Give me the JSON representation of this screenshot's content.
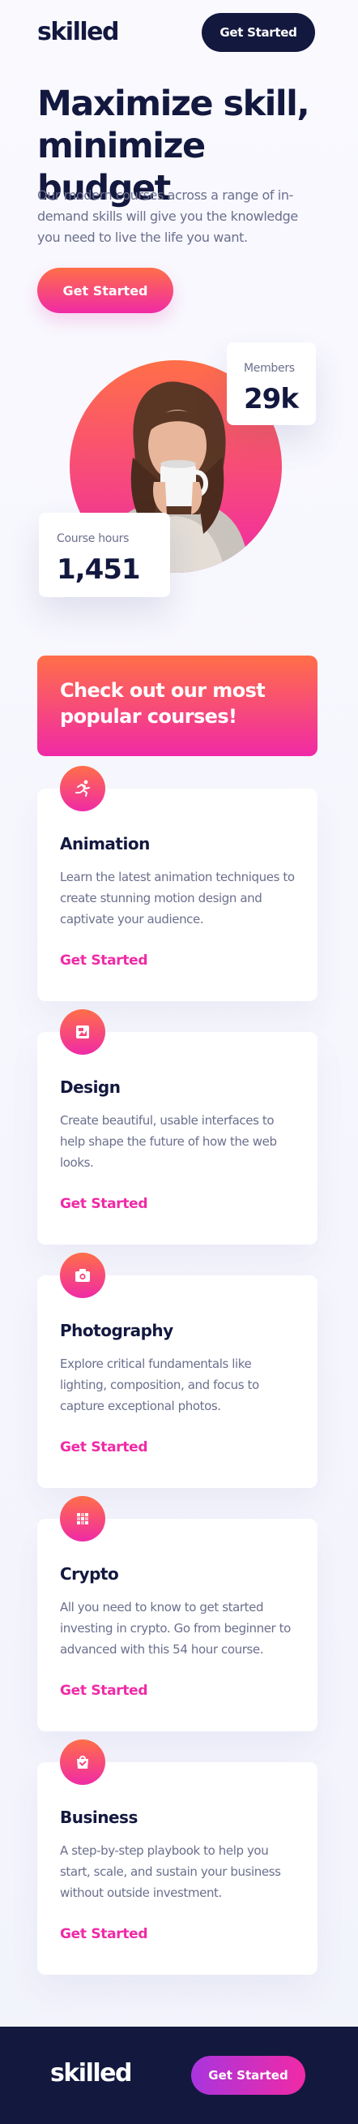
{
  "header": {
    "logo": "skilled",
    "cta": "Get Started"
  },
  "hero": {
    "title": "Maximize skill, minimize budget",
    "text": "Our modern courses across a range of in-demand skills will give you the knowledge you need to live the life you want.",
    "cta": "Get Started"
  },
  "stats": {
    "members_label": "Members",
    "members_value": "29k",
    "hours_label": "Course hours",
    "hours_value": "1,451"
  },
  "popular": {
    "title": "Check out our most popular courses!"
  },
  "courses": [
    {
      "icon": "animation-icon",
      "title": "Animation",
      "description": "Learn the latest animation techniques to create stunning motion design and captivate your audience.",
      "link": "Get Started"
    },
    {
      "icon": "design-icon",
      "title": "Design",
      "description": "Create beautiful, usable interfaces to help shape the future of how the web looks.",
      "link": "Get Started"
    },
    {
      "icon": "camera-icon",
      "title": "Photography",
      "description": "Explore critical fundamentals like lighting, composition, and focus to capture exceptional photos.",
      "link": "Get Started"
    },
    {
      "icon": "crypto-icon",
      "title": "Crypto",
      "description": "All you need to know to get started investing in crypto. Go from beginner to advanced with this 54 hour course.",
      "link": "Get Started"
    },
    {
      "icon": "business-icon",
      "title": "Business",
      "description": "A step-by-step playbook to help you start, scale, and sustain your business without outside investment.",
      "link": "Get Started"
    }
  ],
  "footer": {
    "logo": "skilled",
    "cta": "Get Started"
  },
  "colors": {
    "navy": "#13183f",
    "orange": "#ff6f48",
    "pink": "#f02aa6",
    "purple": "#a935dd",
    "muted_text": "#6b6f8d"
  }
}
